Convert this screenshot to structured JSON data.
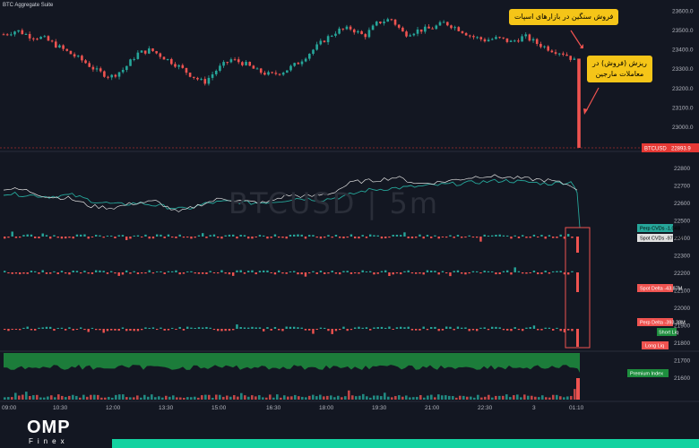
{
  "app": {
    "title": "BTC Aggregate Suite",
    "watermark": "BTCUSD  |  5m"
  },
  "callouts": [
    {
      "text": "فروش سنگین در بازارهای اسپات"
    },
    {
      "line1": "ریزش (فروش) در",
      "line2": "معاملات مارجین"
    }
  ],
  "brand": {
    "logo": "OMP",
    "sub": "Finex"
  },
  "colors": {
    "bg": "#131722",
    "up": "#26a69a",
    "down": "#ef5350",
    "price_label": "#e53935",
    "cvd_perp": "#26a69a",
    "cvd_spot": "#e0e0e0",
    "premium": "#1e8e3e",
    "callout": "#f5c518",
    "accent": "#13d2a0"
  },
  "chart_data": {
    "type": "line",
    "timeframe": "5m",
    "symbol": "BTCUSD",
    "x_ticks": [
      "09:00",
      "10:30",
      "12:00",
      "13:30",
      "15:00",
      "16:30",
      "18:00",
      "19:30",
      "21:00",
      "22:30",
      "3",
      "01:10"
    ],
    "y_ticks_top": [
      23600.0,
      23500.0,
      23400.0,
      23300.0,
      23200.0,
      23100.0,
      23000.0,
      22900.0
    ],
    "y_ticks_bottom": [
      22800,
      22700,
      22600,
      22500,
      22400,
      22300,
      22200,
      22100,
      22000,
      21900,
      21800,
      21700,
      21600
    ],
    "ylim_price": [
      22880,
      23620
    ],
    "price_close": [
      23480,
      23500,
      23470,
      23460,
      23420,
      23380,
      23340,
      23290,
      23260,
      23300,
      23380,
      23400,
      23360,
      23320,
      23270,
      23230,
      23300,
      23350,
      23330,
      23290,
      23270,
      23290,
      23330,
      23390,
      23450,
      23500,
      23510,
      23470,
      23540,
      23560,
      23480,
      23500,
      23510,
      23540,
      23510,
      23470,
      23450,
      23460,
      23440,
      23470,
      23430,
      23400,
      23380,
      23330,
      22893.9
    ],
    "price_label": {
      "name": "BTCUSD",
      "value": "22893.9"
    },
    "cvd": {
      "perp": [
        -0.1,
        -0.2,
        -0.3,
        -0.2,
        -0.6,
        -0.8,
        -0.7,
        -0.9,
        -1.1,
        -0.7,
        -0.6,
        -0.7,
        -0.6,
        -0.4,
        -0.5,
        -0.3,
        0.1,
        0.2,
        0.3,
        0.4,
        0.5,
        0.6,
        0.7,
        0.6,
        0.5,
        0.6,
        0.3,
        -4.0
      ],
      "spot": [
        0.2,
        0.1,
        -0.3,
        -0.4,
        -0.9,
        -1.0,
        -0.7,
        -0.6,
        -1.3,
        -0.8,
        -0.4,
        -0.6,
        -0.7,
        -0.2,
        -0.3,
        -0.1,
        0.6,
        0.7,
        0.9,
        0.5,
        0.6,
        0.8,
        1.0,
        0.9,
        0.8,
        0.7,
        0.4,
        0.2
      ],
      "perp_label": {
        "name": "Perp CVDs",
        "value": "-1.04B"
      },
      "spot_label": {
        "name": "Spot CVDs",
        "value": "-97.58M"
      }
    },
    "delta_rows": [
      {
        "name": "Spot Delta",
        "value": "-43.87M"
      },
      {
        "name": "Perp Delta",
        "value": "-393.38M"
      },
      {
        "name": "Short Liq",
        "value": ""
      }
    ],
    "labels_extra": [
      "Long Liq",
      "Premium Index"
    ]
  }
}
